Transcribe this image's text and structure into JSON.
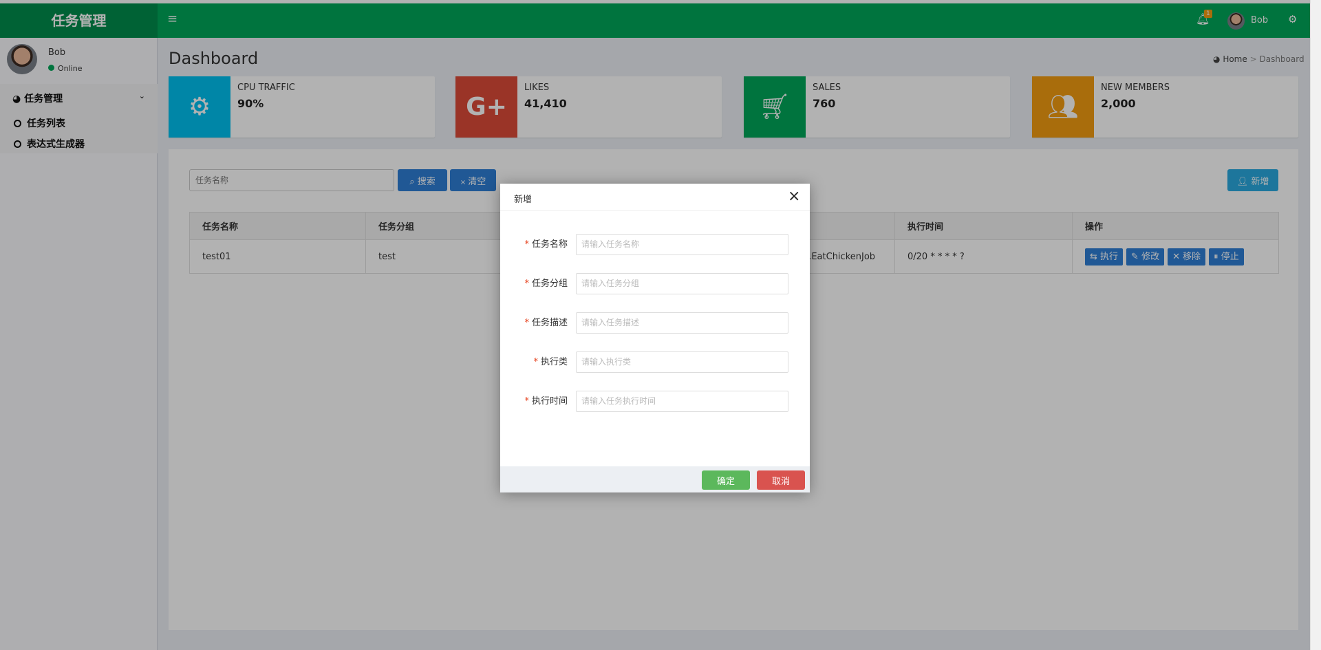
{
  "app": {
    "title": "任务管理",
    "notification_count": "1",
    "user": "Bob"
  },
  "sidebar": {
    "user": "Bob",
    "status": "Online",
    "menu": {
      "label": "任务管理",
      "items": [
        {
          "label": "任务列表"
        },
        {
          "label": "表达式生成器"
        }
      ]
    }
  },
  "page": {
    "title": "Dashboard",
    "breadcrumb": {
      "home": "Home",
      "sep": ">",
      "current": "Dashboard"
    }
  },
  "infoboxes": [
    {
      "label": "CPU TRAFFIC",
      "value": "90%",
      "icon": "gear-icon",
      "color": "#00c0ef"
    },
    {
      "label": "LIKES",
      "value": "41,410",
      "icon": "google-plus-icon",
      "color": "#dd4b39"
    },
    {
      "label": "SALES",
      "value": "760",
      "icon": "cart-icon",
      "color": "#00a65a"
    },
    {
      "label": "NEW MEMBERS",
      "value": "2,000",
      "icon": "users-icon",
      "color": "#f39c12"
    }
  ],
  "toolbar": {
    "search_placeholder": "任务名称",
    "search_label": "搜索",
    "clear_label": "清空",
    "add_label": "新增"
  },
  "table": {
    "headers": [
      "任务名称",
      "任务分组",
      "",
      "",
      "执行时间",
      "操作"
    ],
    "rows": [
      {
        "name": "test01",
        "group": "test",
        "desc": "",
        "class": "ob.EatChickenJob",
        "cron": "0/20 * * * * ?"
      }
    ],
    "actions": [
      "执行",
      "修改",
      "移除",
      "停止"
    ]
  },
  "modal": {
    "title": "新增",
    "fields": [
      {
        "label": "任务名称",
        "placeholder": "请输入任务名称"
      },
      {
        "label": "任务分组",
        "placeholder": "请输入任务分组"
      },
      {
        "label": "任务描述",
        "placeholder": "请输入任务描述"
      },
      {
        "label": "执行类",
        "placeholder": "请输入执行类"
      },
      {
        "label": "执行时间",
        "placeholder": "请输入任务执行时间"
      }
    ],
    "ok_label": "确定",
    "cancel_label": "取消"
  }
}
